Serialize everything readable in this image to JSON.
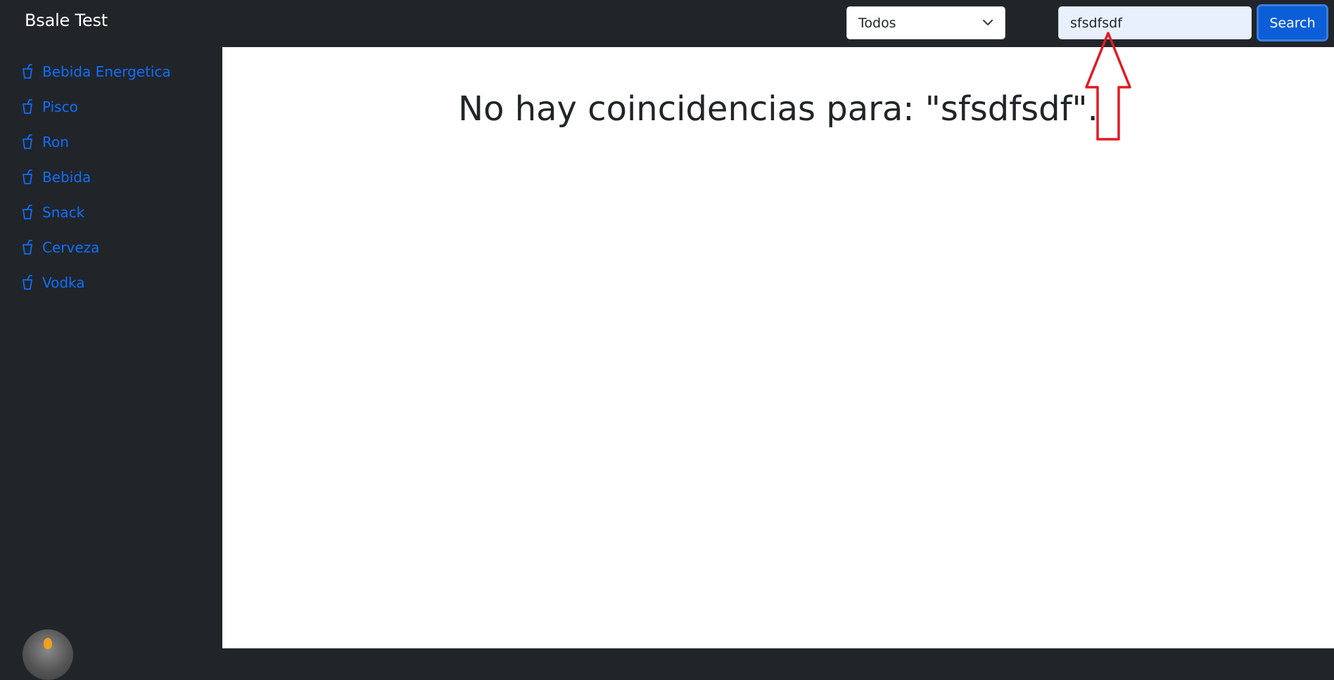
{
  "navbar": {
    "brand": "Bsale Test",
    "filter": {
      "selected": "Todos"
    },
    "search": {
      "value": "sfsdfsdf",
      "button_label": "Search"
    }
  },
  "sidebar": {
    "items": [
      {
        "label": "Bebida Energetica",
        "icon": "cup-straw-icon"
      },
      {
        "label": "Pisco",
        "icon": "cup-straw-icon"
      },
      {
        "label": "Ron",
        "icon": "cup-straw-icon"
      },
      {
        "label": "Bebida",
        "icon": "cup-straw-icon"
      },
      {
        "label": "Snack",
        "icon": "cup-straw-icon"
      },
      {
        "label": "Cerveza",
        "icon": "cup-straw-icon"
      },
      {
        "label": "Vodka",
        "icon": "cup-straw-icon"
      }
    ]
  },
  "main": {
    "message": "No hay coincidencias para: \"sfsdfsdf\"."
  },
  "colors": {
    "dark": "#212529",
    "link": "#0d6efd",
    "button": "#0b5ed7",
    "annotation_arrow": "#e01b24"
  }
}
